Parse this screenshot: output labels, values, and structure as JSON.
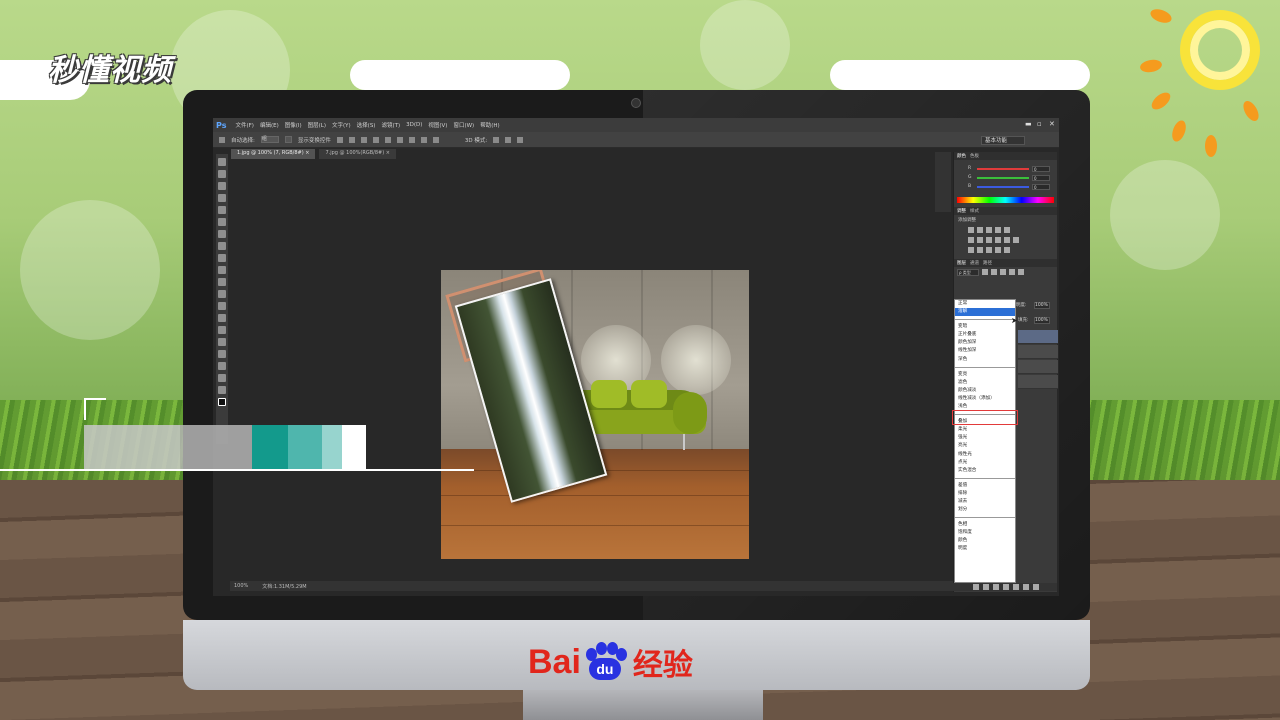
{
  "brand": {
    "logo_text": "秒懂视频"
  },
  "footer": {
    "baidu_bai": "Bai",
    "baidu_du": "du",
    "baidu_jingyan": "经验"
  },
  "photoshop": {
    "logo": "Ps",
    "menu": [
      "文件(F)",
      "编辑(E)",
      "图像(I)",
      "图层(L)",
      "文字(Y)",
      "选择(S)",
      "滤镜(T)",
      "3D(D)",
      "视图(V)",
      "窗口(W)",
      "帮助(H)"
    ],
    "options": {
      "auto_select": "自动选择:",
      "auto_select_value": "组",
      "show_transform": "显示变换控件",
      "mode_3d": "3D 模式:"
    },
    "workspace": "基本功能",
    "tabs": [
      "1.jpg @ 100% (7, RGB/8#) ×",
      "7.jpg @ 100%(RGB/8#) ×"
    ],
    "status": {
      "zoom": "100%",
      "doc": "文档:1.31M/5.29M"
    },
    "panels": {
      "color_tabs": [
        "颜色",
        "色板"
      ],
      "color_channels": [
        {
          "label": "R",
          "value": "0",
          "color": "#e03b3b"
        },
        {
          "label": "G",
          "value": "0",
          "color": "#3bbf3b"
        },
        {
          "label": "B",
          "value": "0",
          "color": "#3b5be0"
        }
      ],
      "adjust_tabs": [
        "调整",
        "样式"
      ],
      "adjust_title": "添加调整",
      "layer_tabs": [
        "图层",
        "通道",
        "路径"
      ],
      "layer_kind": "ρ 类型",
      "blend_current": "正常",
      "opacity_label": "不透明度:",
      "opacity_value": "100%",
      "fill_label": "填充:",
      "fill_value": "100%"
    },
    "blend_modes": [
      [
        "正常",
        "溶解"
      ],
      [
        "变暗",
        "正片叠底",
        "颜色加深",
        "线性加深",
        "深色"
      ],
      [
        "变亮",
        "滤色",
        "颜色减淡",
        "线性减淡（添加）",
        "浅色"
      ],
      [
        "叠加",
        "柔光",
        "强光",
        "亮光",
        "线性光",
        "点光",
        "实色混合"
      ],
      [
        "差值",
        "排除",
        "减去",
        "划分"
      ],
      [
        "色相",
        "饱和度",
        "颜色",
        "明度"
      ]
    ],
    "highlighted_mode": "溶解",
    "boxed_mode": "滤色"
  },
  "overlay_colors": [
    "#c8c8c8",
    "#b4b4b4",
    "#139a8c",
    "#4fb6ad",
    "#97d4ce",
    "#ffffff"
  ]
}
